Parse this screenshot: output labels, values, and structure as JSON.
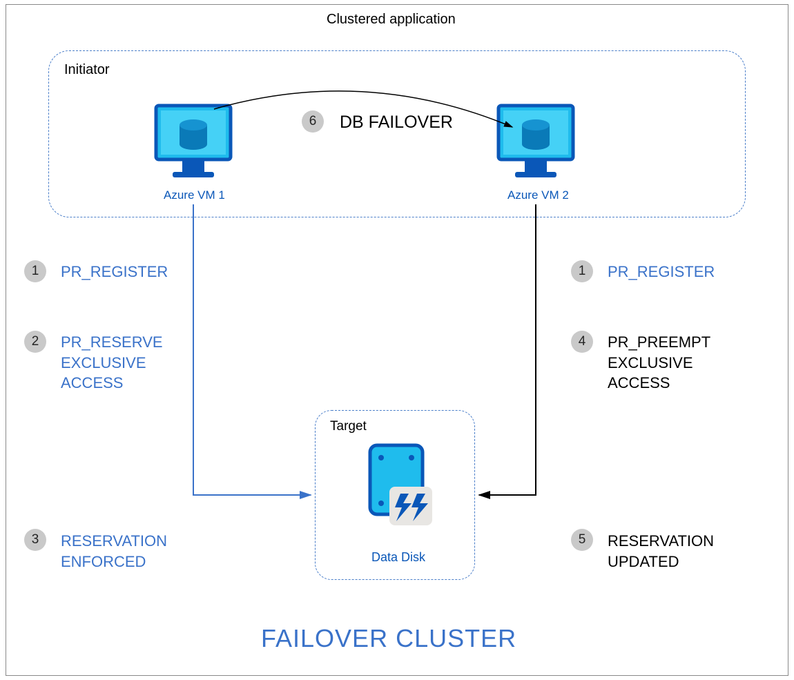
{
  "diagram": {
    "title": "Clustered application",
    "initiator_label": "Initiator",
    "vm1_label": "Azure VM 1",
    "vm2_label": "Azure VM 2",
    "target_label": "Target",
    "disk_label": "Data Disk",
    "footer": "FAILOVER CLUSTER",
    "failover_label": "DB FAILOVER",
    "steps": {
      "s1_left": {
        "num": "1",
        "text": "PR_REGISTER"
      },
      "s1_right": {
        "num": "1",
        "text": "PR_REGISTER"
      },
      "s2": {
        "num": "2",
        "text": "PR_RESERVE\nEXCLUSIVE\nACCESS"
      },
      "s3": {
        "num": "3",
        "text": "RESERVATION\nENFORCED"
      },
      "s4": {
        "num": "4",
        "text": "PR_PREEMPT\nEXCLUSIVE\nACCESS"
      },
      "s5": {
        "num": "5",
        "text": "RESERVATION\nUPDATED"
      },
      "s6": {
        "num": "6"
      }
    }
  }
}
